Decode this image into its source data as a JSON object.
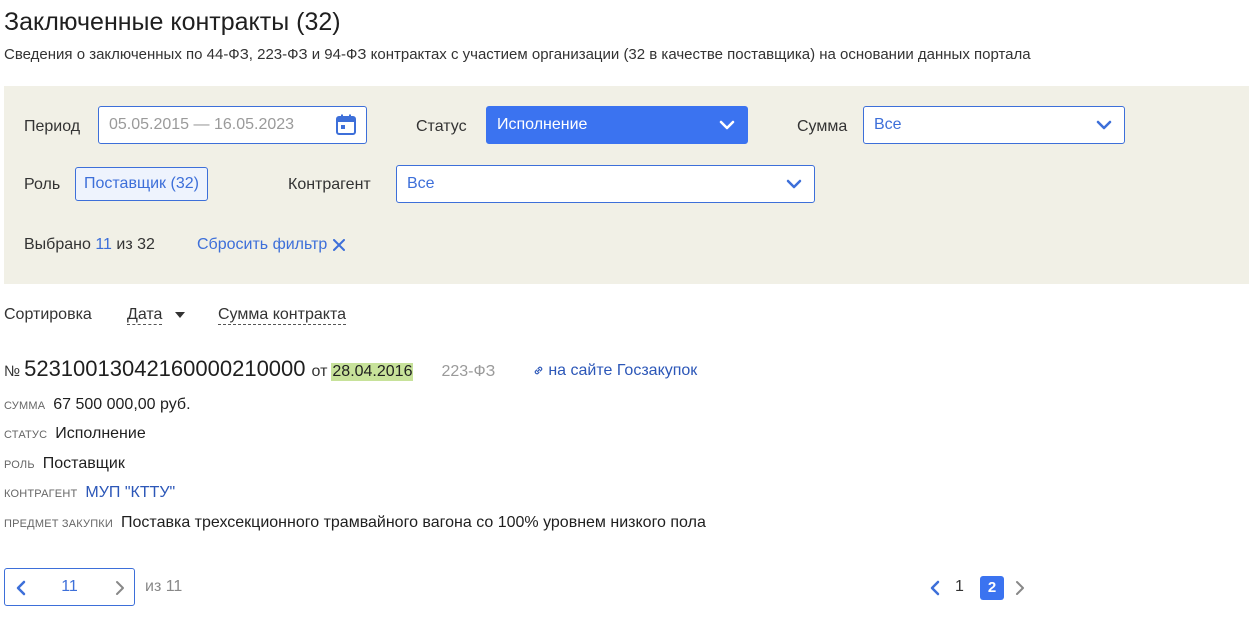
{
  "header": {
    "title": "Заключенные контракты (32)",
    "subtitle": "Сведения о заключенных по 44-ФЗ, 223-ФЗ и 94-ФЗ контрактах с участием организации (32 в качестве поставщика) на основании данных портала"
  },
  "filters": {
    "period_label": "Период",
    "period_value": "05.05.2015 — 16.05.2023",
    "status_label": "Статус",
    "status_value": "Исполнение",
    "sum_label": "Сумма",
    "sum_value": "Все",
    "role_label": "Роль",
    "role_value": "Поставщик (32)",
    "counterparty_label": "Контрагент",
    "counterparty_value": "Все",
    "selected_prefix": "Выбрано",
    "selected_count": "11",
    "selected_of": "из 32",
    "reset_label": "Сбросить фильтр"
  },
  "sort": {
    "label": "Сортировка",
    "by_date": "Дата",
    "by_sum": "Сумма контракта"
  },
  "contract": {
    "num_sign": "№",
    "number": "52310013042160000210000",
    "from_word": "от",
    "date": "28.04.2016",
    "law": "223-ФЗ",
    "gosz_link": "на сайте Госзакупок",
    "fields": {
      "sum_key": "Сумма",
      "sum_val": "67 500 000,00 руб.",
      "status_key": "Статус",
      "status_val": "Исполнение",
      "role_key": "Роль",
      "role_val": "Поставщик",
      "counterparty_key": "Контрагент",
      "counterparty_val": "МУП \"КТТУ\"",
      "subject_key": "Предмет закупки",
      "subject_val": "Поставка трехсекционного трамвайного вагона со 100% уровнем низкого пола"
    }
  },
  "pager": {
    "current": "11",
    "of_total": "из 11",
    "pages": [
      "1",
      "2"
    ]
  },
  "colors": {
    "accent": "#3b73f0",
    "filter_bg": "#f1f0e6",
    "date_highlight": "#c7e29a"
  }
}
